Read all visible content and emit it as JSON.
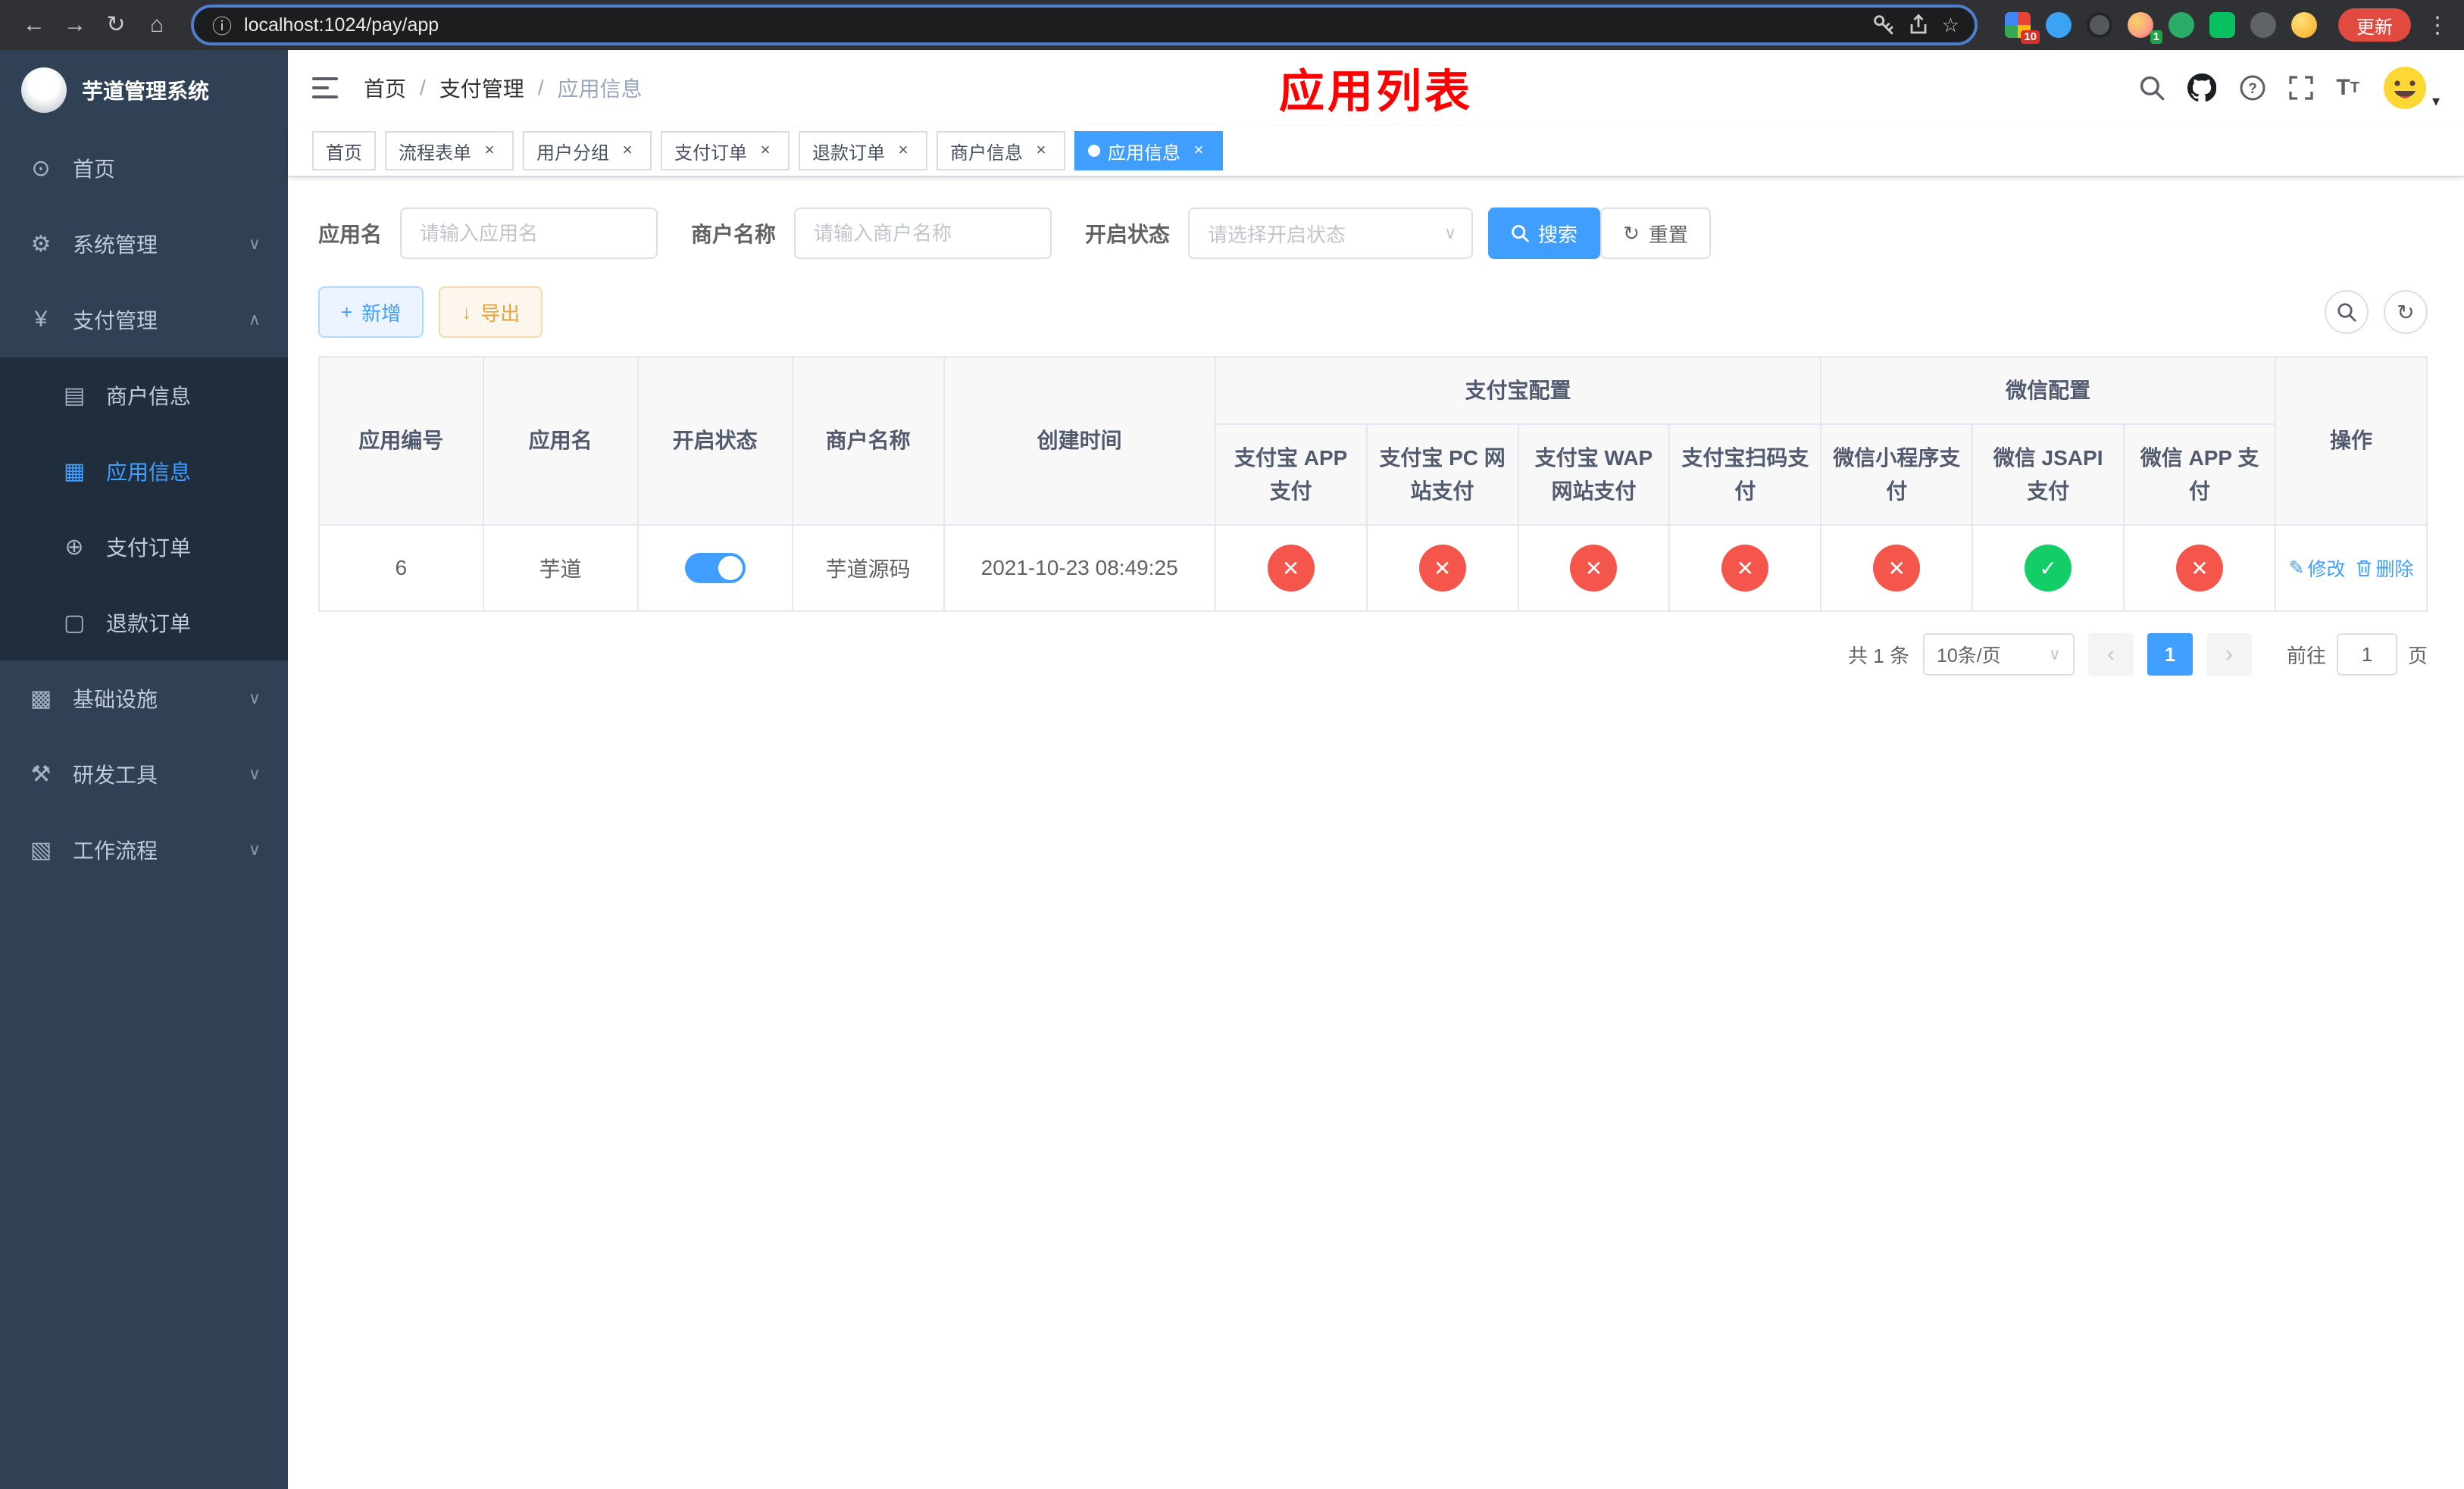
{
  "colors": {
    "accent": "#409EFF",
    "danger": "#F5564C",
    "success": "#13CE66",
    "warning": "#E6A23C",
    "sidebar_bg": "#304156",
    "submenu_bg": "#1F2D3D",
    "page_title_red": "#FF0000"
  },
  "icons": {
    "back": "←",
    "forward": "→",
    "reload": "↻",
    "home": "⌂",
    "info": "ⓘ",
    "star": "☆",
    "menu_dots": "⋮",
    "dashboard": "⊙",
    "gear": "⚙",
    "yen": "¥",
    "merchant": "▤",
    "app": "▦",
    "order": "⊕",
    "refund": "▢",
    "infra": "▩",
    "tools": "⚒",
    "workflow": "▧",
    "chevron_down": "∨",
    "chevron_up": "∧",
    "close": "×",
    "plus": "+",
    "download": "↓",
    "refresh": "↻",
    "edit": "✎",
    "prev": "‹",
    "next": "›",
    "caret_down": "▾",
    "question": "?",
    "letter_t": "T"
  },
  "browser": {
    "url": "localhost:1024/pay/app",
    "update_label": "更新",
    "ext_badge_tabs": "10",
    "ext_badge_other": "1"
  },
  "sidebar": {
    "logo_title": "芋道管理系统",
    "items": [
      {
        "label": "首页"
      },
      {
        "label": "系统管理"
      },
      {
        "label": "支付管理",
        "children": [
          {
            "label": "商户信息"
          },
          {
            "label": "应用信息"
          },
          {
            "label": "支付订单"
          },
          {
            "label": "退款订单"
          }
        ]
      },
      {
        "label": "基础设施"
      },
      {
        "label": "研发工具"
      },
      {
        "label": "工作流程"
      }
    ]
  },
  "header": {
    "breadcrumb": [
      "首页",
      "支付管理",
      "应用信息"
    ],
    "breadcrumb_separator": "/",
    "page_title": "应用列表"
  },
  "tabs": [
    {
      "label": "首页"
    },
    {
      "label": "流程表单"
    },
    {
      "label": "用户分组"
    },
    {
      "label": "支付订单"
    },
    {
      "label": "退款订单"
    },
    {
      "label": "商户信息"
    },
    {
      "label": "应用信息"
    }
  ],
  "filters": {
    "app_name_label": "应用名",
    "app_name_placeholder": "请输入应用名",
    "merchant_label": "商户名称",
    "merchant_placeholder": "请输入商户名称",
    "status_label": "开启状态",
    "status_placeholder": "请选择开启状态",
    "search_label": "搜索",
    "reset_label": "重置"
  },
  "toolbar": {
    "add_label": "新增",
    "export_label": "导出"
  },
  "table": {
    "columns": {
      "id": "应用编号",
      "name": "应用名",
      "status": "开启状态",
      "merchant": "商户名称",
      "created": "创建时间",
      "ops": "操作"
    },
    "groups": {
      "alipay": "支付宝配置",
      "wechat": "微信配置"
    },
    "sub_columns": [
      "支付宝 APP 支付",
      "支付宝 PC 网站支付",
      "支付宝 WAP 网站支付",
      "支付宝扫码支付",
      "微信小程序支付",
      "微信 JSAPI 支付",
      "微信 APP 支付"
    ],
    "rows": [
      {
        "id": "6",
        "name": "芋道",
        "switch_state": "on",
        "merchant": "芋道源码",
        "created": "2021-10-23 08:49:25",
        "configs": [
          "fail",
          "fail",
          "fail",
          "fail",
          "fail",
          "success",
          "fail"
        ],
        "edit_label": "修改",
        "delete_label": "删除"
      }
    ]
  },
  "pagination": {
    "total": "共 1 条",
    "page_size": "10条/页",
    "current_page": "1",
    "goto_label": "前往",
    "goto_value": "1",
    "goto_unit": "页"
  }
}
